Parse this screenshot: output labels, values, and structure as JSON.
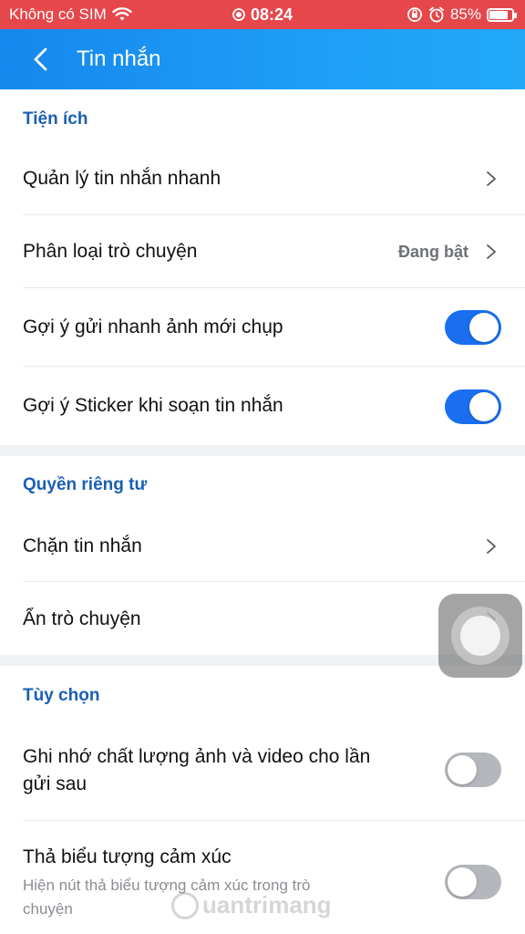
{
  "status_bar": {
    "carrier": "Không có SIM",
    "time": "08:24",
    "battery_percent": "85%",
    "battery_level": 0.85
  },
  "header": {
    "title": "Tin nhắn",
    "back_icon": "chevron-left-icon"
  },
  "sections": {
    "utilities": {
      "title": "Tiện ích",
      "quick_messages": {
        "label": "Quản lý tin nhắn nhanh"
      },
      "conversation_classify": {
        "label": "Phân loại trò chuyện",
        "value": "Đang bật"
      },
      "suggest_photo": {
        "label": "Gợi ý gửi nhanh ảnh mới chụp",
        "enabled": true
      },
      "suggest_sticker": {
        "label": "Gợi ý Sticker khi soạn tin nhắn",
        "enabled": true
      }
    },
    "privacy": {
      "title": "Quyền riêng tư",
      "block_messages": {
        "label": "Chặn tin nhắn"
      },
      "hide_conversation": {
        "label": "Ẩn trò chuyện"
      }
    },
    "options": {
      "title": "Tùy chọn",
      "remember_quality": {
        "label_line1": "Ghi nhớ chất lượng ảnh và video cho lần",
        "label_line2": "gửi sau",
        "enabled": false
      },
      "reaction": {
        "label": "Thả biểu tượng cảm xúc",
        "sub_line1": "Hiện nút thả biểu tượng cảm xúc trong trò",
        "sub_line2": "chuyện",
        "enabled": false
      }
    }
  },
  "watermark": "uantrimang",
  "colors": {
    "status_bar": "#e5474b",
    "header_gradient_start": "#1687ee",
    "header_gradient_end": "#21a9f8",
    "section_title": "#1a5fb4",
    "toggle_on": "#1a6ff0",
    "toggle_off": "#b4b7bc"
  }
}
